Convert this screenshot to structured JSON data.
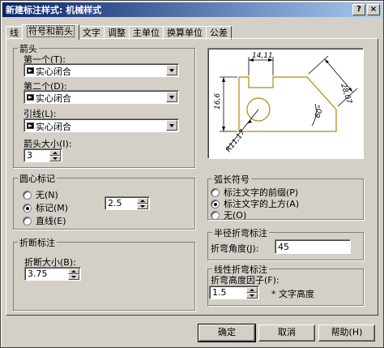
{
  "title": "新建标注样式: 机械样式",
  "titlebar_buttons": {
    "help": "?",
    "close": "×"
  },
  "tabs": [
    "线",
    "符号和箭头",
    "文字",
    "调整",
    "主单位",
    "换算单位",
    "公差"
  ],
  "active_tab": "符号和箭头",
  "arrows": {
    "group_title": "箭头",
    "first_label": "第一个(T):",
    "first_value": "实心闭合",
    "second_label": "第二个(D):",
    "second_value": "实心闭合",
    "leader_label": "引线(L):",
    "leader_value": "实心闭合",
    "size_label": "箭头大小(I):",
    "size_value": "3"
  },
  "center_marks": {
    "group_title": "圆心标记",
    "options": [
      "无(N)",
      "标记(M)",
      "直线(E)"
    ],
    "selected": "标记(M)",
    "size_value": "2.5"
  },
  "break": {
    "group_title": "折断标注",
    "size_label": "折断大小(B):",
    "size_value": "3.75"
  },
  "arc_length": {
    "group_title": "弧长符号",
    "options": [
      "标注文字的前缀(P)",
      "标注文字的上方(A)",
      "无(O)"
    ],
    "selected": "标注文字的上方(A)"
  },
  "radius_jog": {
    "group_title": "半径折弯标注",
    "angle_label": "折弯角度(J):",
    "angle_value": "45"
  },
  "linear_jog": {
    "group_title": "线性折弯标注",
    "factor_label": "折弯高度因子(F):",
    "factor_value": "1.5",
    "unit_text": "* 文字高度"
  },
  "preview": {
    "dim_top": "14,11",
    "dim_left": "16,6",
    "dim_right": "28,07",
    "dim_angle": "60°",
    "dim_radius": "R11,17"
  },
  "buttons": {
    "ok": "确定",
    "cancel": "取消",
    "help": "帮助(H)"
  },
  "colors": {
    "titlebar": "#0a246a",
    "dialog": "#d4d0c8",
    "preview_shape": "#b8860b"
  }
}
